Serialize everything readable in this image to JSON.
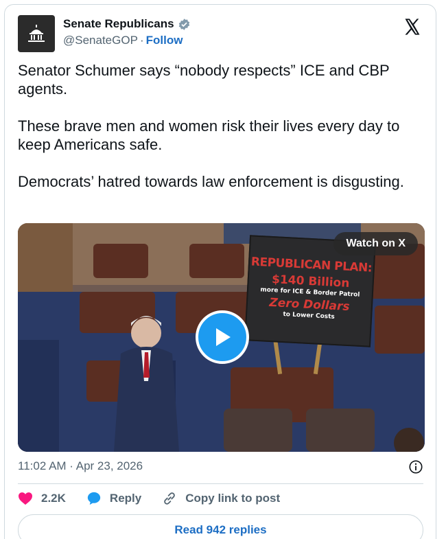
{
  "author": {
    "display_name": "Senate Republicans",
    "handle": "@SenateGOP",
    "separator": "·",
    "follow_label": "Follow",
    "verified": true,
    "avatar_icon": "capitol-dome-icon"
  },
  "platform_icon": "x-logo-icon",
  "tweet": {
    "text": "Senator Schumer says “nobody respects” ICE and CBP agents.\n\nThese brave men and women risk their lives every day to keep Americans safe.\n\nDemocrats’ hatred towards law enforcement is disgusting."
  },
  "media": {
    "watch_label": "Watch on X",
    "play_icon": "play-icon",
    "sign": {
      "line1": "REPUBLICAN PLAN:",
      "line2": "$140 Billion",
      "line3": "more for ICE & Border Patrol",
      "line4": "Zero Dollars",
      "line5": "to Lower Costs"
    }
  },
  "meta": {
    "timestamp": "11:02 AM · Apr 23, 2026",
    "info_icon": "info-icon"
  },
  "actions": {
    "likes_count": "2.2K",
    "reply_label": "Reply",
    "copy_link_label": "Copy link to post"
  },
  "footer": {
    "read_replies_label": "Read 942 replies"
  },
  "colors": {
    "accent": "#1d9bf0",
    "link": "#1d6ec4",
    "like": "#f91880",
    "muted": "#536471",
    "sign_red": "#d83a36"
  }
}
